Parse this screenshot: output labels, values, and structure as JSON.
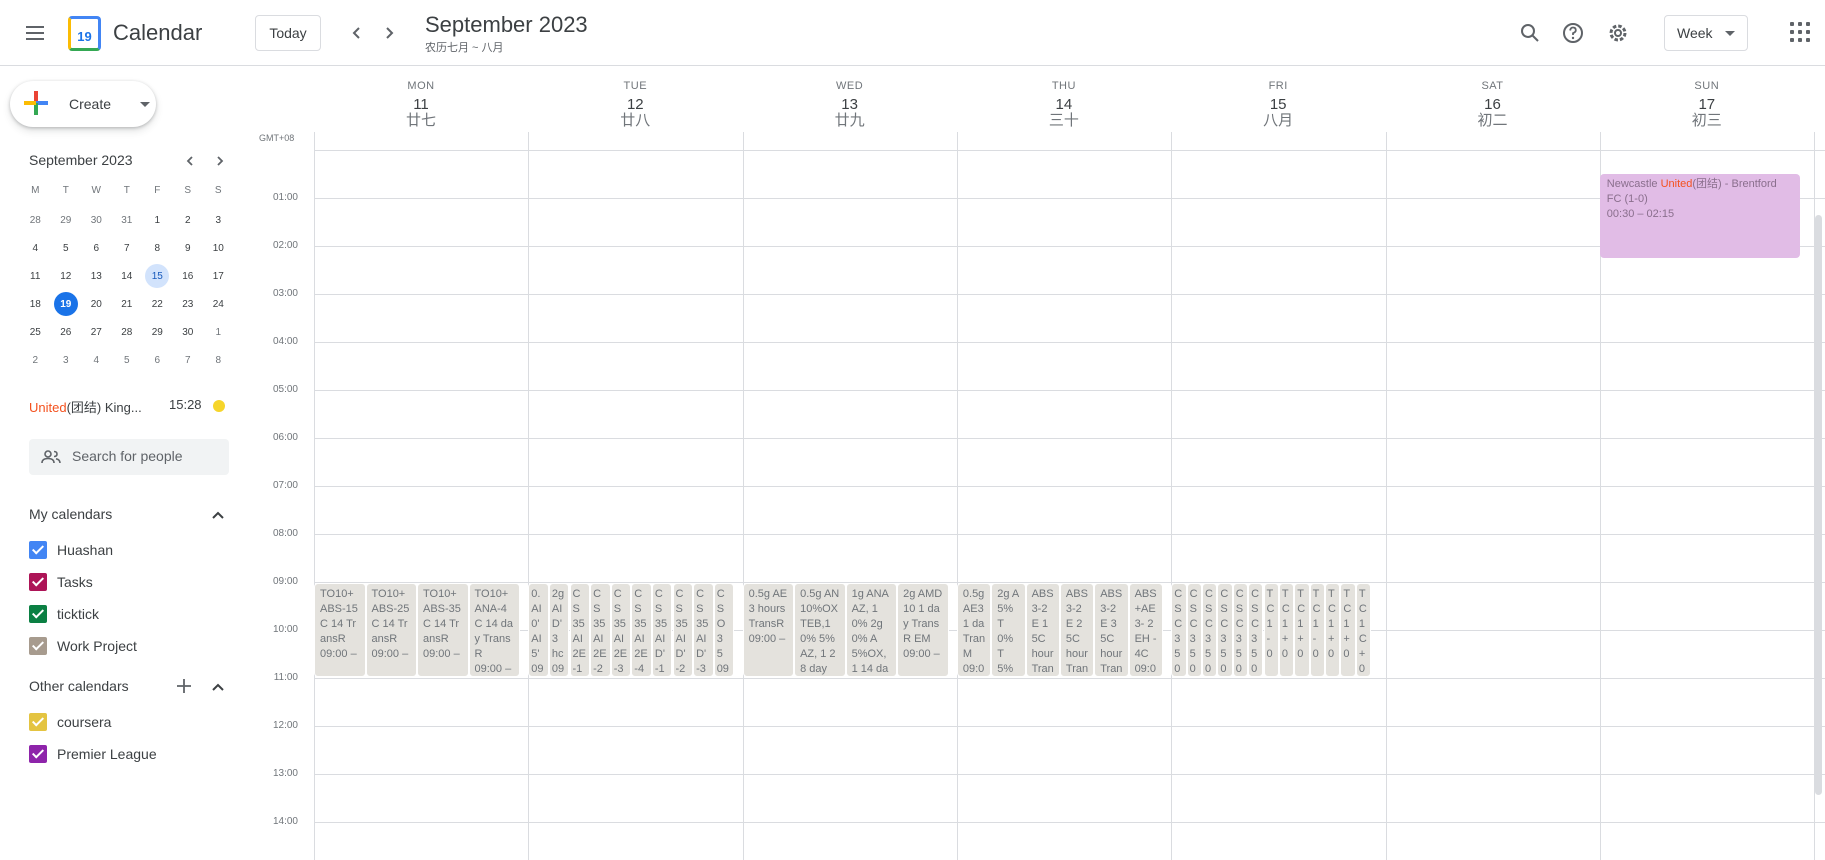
{
  "header": {
    "app_title": "Calendar",
    "logo_day": "19",
    "today_label": "Today",
    "period_title": "September 2023",
    "period_subtitle": "农历七月 ~ 八月",
    "view_label": "Week",
    "icons": [
      "menu-icon",
      "search-icon",
      "help-icon",
      "settings-icon",
      "apps-icon"
    ]
  },
  "sidebar": {
    "create_label": "Create",
    "mini_cal": {
      "title": "September 2023",
      "weekday_headers": [
        "M",
        "T",
        "W",
        "T",
        "F",
        "S",
        "S"
      ],
      "weeks": [
        [
          "28",
          "29",
          "30",
          "31",
          "1",
          "2",
          "3"
        ],
        [
          "4",
          "5",
          "6",
          "7",
          "8",
          "9",
          "10"
        ],
        [
          "11",
          "12",
          "13",
          "14",
          "15",
          "16",
          "17"
        ],
        [
          "18",
          "19",
          "20",
          "21",
          "22",
          "23",
          "24"
        ],
        [
          "25",
          "26",
          "27",
          "28",
          "29",
          "30",
          "1"
        ],
        [
          "2",
          "3",
          "4",
          "5",
          "6",
          "7",
          "8"
        ]
      ],
      "today": "19",
      "selected": "15"
    },
    "match": {
      "team": "United",
      "rest": "(团结) King...",
      "time": "15:28"
    },
    "people_search_placeholder": "Search for people",
    "my_calendars_title": "My calendars",
    "my_calendars": [
      {
        "name": "Huashan",
        "color": "#4285f4"
      },
      {
        "name": "Tasks",
        "color": "#ad1457"
      },
      {
        "name": "ticktick",
        "color": "#0b8043"
      },
      {
        "name": "Work Project",
        "color": "#a79b8e"
      }
    ],
    "other_calendars_title": "Other calendars",
    "other_calendars": [
      {
        "name": "coursera",
        "color": "#e4c441"
      },
      {
        "name": "Premier League",
        "color": "#8e24aa"
      }
    ]
  },
  "grid": {
    "timezone": "GMT+08",
    "days": [
      {
        "dow": "MON",
        "num": "11",
        "lunar": "廿七"
      },
      {
        "dow": "TUE",
        "num": "12",
        "lunar": "廿八"
      },
      {
        "dow": "WED",
        "num": "13",
        "lunar": "廿九"
      },
      {
        "dow": "THU",
        "num": "14",
        "lunar": "三十"
      },
      {
        "dow": "FRI",
        "num": "15",
        "lunar": "八月"
      },
      {
        "dow": "SAT",
        "num": "16",
        "lunar": "初二"
      },
      {
        "dow": "SUN",
        "num": "17",
        "lunar": "初三"
      }
    ],
    "hours": [
      "01:00",
      "02:00",
      "03:00",
      "04:00",
      "05:00",
      "06:00",
      "07:00",
      "08:00",
      "09:00",
      "10:00",
      "11:00",
      "12:00",
      "13:00",
      "14:00"
    ]
  },
  "events": {
    "mon": [
      {
        "title": "TO10+ABS-15C 14 TransR",
        "time": "09:00 –"
      },
      {
        "title": "TO10+ABS-25C 14 TransR",
        "time": "09:00 –"
      },
      {
        "title": "TO10+ABS-35C 14 TransR",
        "time": "09:00 –"
      },
      {
        "title": "TO10+ ANA-4C 14 day TransR",
        "time": "09:00 –"
      }
    ],
    "tue": [
      {
        "title": "0. AI 0' AI 5'",
        "time": "09"
      },
      {
        "title": "2g AI D' 3 hc",
        "time": "09"
      },
      {
        "title": "CS 35 AI 2E -1",
        "time": "09"
      },
      {
        "title": "CS 35 AI 2E -2",
        "time": "09"
      },
      {
        "title": "CS 35 AI 2E -3",
        "time": "09"
      },
      {
        "title": "CS 35 AI 2E -4",
        "time": "09"
      },
      {
        "title": "CS 35 AI D' -1",
        "time": "09"
      },
      {
        "title": "CS 35 AI D' -2",
        "time": "09"
      },
      {
        "title": "CS 35 AI D' -3",
        "time": "09"
      },
      {
        "title": "C S O 3 5",
        "time": "09"
      }
    ],
    "wed": [
      {
        "title": "0.5g AE 3 hours TransR",
        "time": "09:00 –"
      },
      {
        "title": "0.5g AN 10%OX TEB,10% 5%AZ, 1 28 day",
        "time": "09:00 –"
      },
      {
        "title": "1g ANA AZ, 10% 2g 0% A 5%OX,1 14 day",
        "time": "09:00 –"
      },
      {
        "title": "2g AMD10 1 day TransR EM",
        "time": "09:00 –"
      }
    ],
    "thu": [
      {
        "title": "0.5g AE3 1 da Tran M",
        "time": "09:0"
      },
      {
        "title": "2g A 5%T 0%T 5%A %AZ",
        "time": "09:0"
      },
      {
        "title": "ABS 3-2E 15C hour Tran",
        "time": "09:0"
      },
      {
        "title": "ABS 3-2E 25C hour Tran",
        "time": "09:0"
      },
      {
        "title": "ABS 3-2E 35C hour Tran",
        "time": "09:0"
      },
      {
        "title": "ABS +AE 3- 2EH -4C",
        "time": "09:0"
      }
    ],
    "fri": [
      {
        "title": "C S C 3 5",
        "time": "0"
      },
      {
        "title": "C S C 3 5",
        "time": "0"
      },
      {
        "title": "C S C 3 5",
        "time": "0"
      },
      {
        "title": "C S C 3 5",
        "time": "0"
      },
      {
        "title": "C S C 3 5",
        "time": "0"
      },
      {
        "title": "C S C 3 5",
        "time": "0"
      },
      {
        "title": "T C 1 -",
        "time": "0"
      },
      {
        "title": "T C 1 +",
        "time": "0"
      },
      {
        "title": "T C 1 +",
        "time": "0"
      },
      {
        "title": "T C 1 -",
        "time": "0"
      },
      {
        "title": "T C 1 +",
        "time": "0"
      },
      {
        "title": "T C 1 +",
        "time": "0"
      },
      {
        "title": "T C 1 C +",
        "time": "0"
      }
    ],
    "sun": {
      "title_pre": "Newcastle ",
      "title_team": "United",
      "title_post": "(团结) - Brentford FC (1-0)",
      "time": "00:30 – 02:15"
    }
  }
}
